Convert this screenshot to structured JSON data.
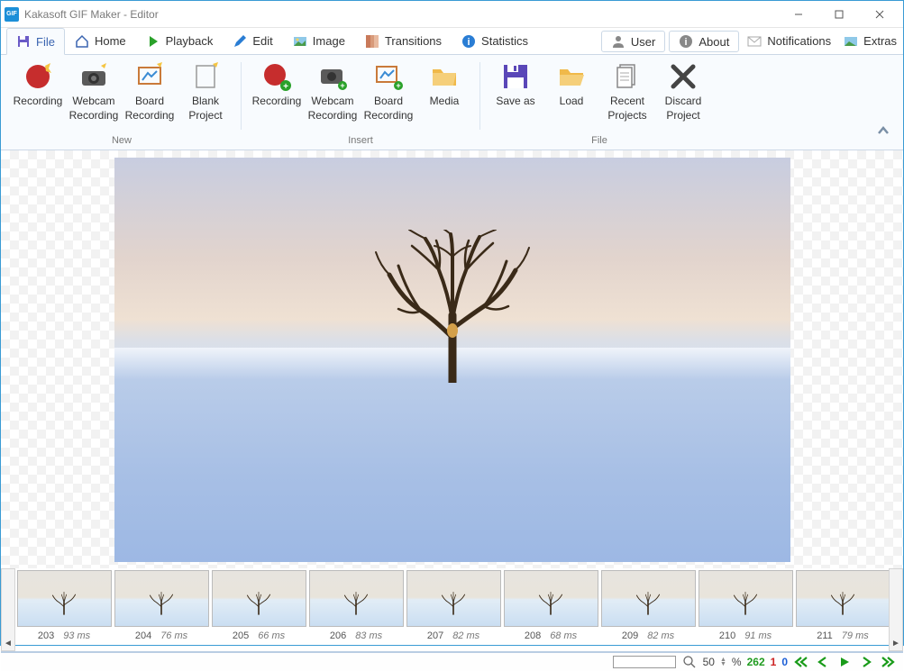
{
  "window": {
    "title": "Kakasoft GIF Maker - Editor",
    "app_icon_text": "GIF"
  },
  "tabs": {
    "file": "File",
    "home": "Home",
    "playback": "Playback",
    "edit": "Edit",
    "image": "Image",
    "transitions": "Transitions",
    "statistics": "Statistics",
    "user": "User",
    "about": "About",
    "notifications": "Notifications",
    "extras": "Extras"
  },
  "ribbon": {
    "groups": {
      "new": "New",
      "insert": "Insert",
      "file": "File"
    },
    "new": {
      "recording": "Recording",
      "webcam": "Webcam Recording",
      "board": "Board Recording",
      "blank": "Blank Project"
    },
    "insert": {
      "recording": "Recording",
      "webcam": "Webcam Recording",
      "board": "Board Recording",
      "media": "Media"
    },
    "file": {
      "saveas": "Save as",
      "load": "Load",
      "recent": "Recent Projects",
      "discard": "Discard Project"
    }
  },
  "frames": [
    {
      "n": "203",
      "ms": "93 ms"
    },
    {
      "n": "204",
      "ms": "76 ms"
    },
    {
      "n": "205",
      "ms": "66 ms"
    },
    {
      "n": "206",
      "ms": "83 ms"
    },
    {
      "n": "207",
      "ms": "82 ms"
    },
    {
      "n": "208",
      "ms": "68 ms"
    },
    {
      "n": "209",
      "ms": "82 ms"
    },
    {
      "n": "210",
      "ms": "91 ms"
    },
    {
      "n": "211",
      "ms": "79 ms"
    }
  ],
  "footer": {
    "zoom": "50",
    "pct": "%",
    "frames_total": "262",
    "deleted": "1",
    "locked": "0"
  }
}
